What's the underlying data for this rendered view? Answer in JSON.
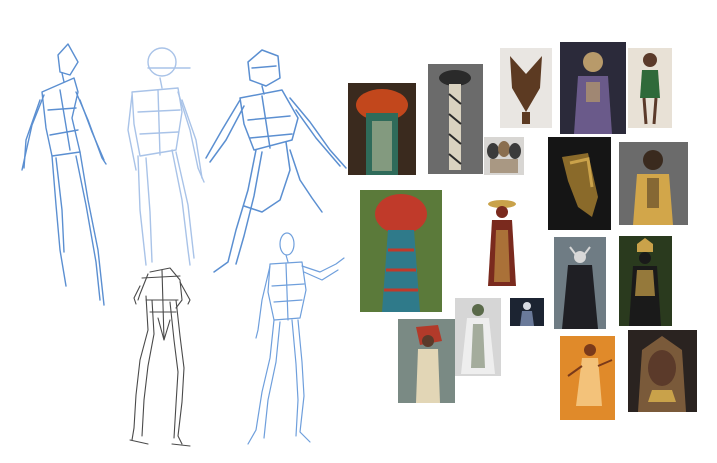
{
  "canvas": {
    "background": "#ffffff"
  },
  "sketch_colors": {
    "blue": "#5b8fd1",
    "light_blue": "#a9c3e8",
    "gray": "#4a4a4a",
    "mid_blue": "#6f9fdc"
  },
  "figure_sketches": [
    {
      "name": "gesture-figure-blue-standing",
      "color": "#5b8fd1"
    },
    {
      "name": "gesture-figure-lightblue-standing",
      "color": "#a9c3e8"
    },
    {
      "name": "gesture-figure-blue-action-pose",
      "color": "#5b8fd1"
    },
    {
      "name": "anatomy-figure-gray-front",
      "color": "#4a4a4a"
    },
    {
      "name": "anatomy-figure-blue-front",
      "color": "#6f9fdc"
    }
  ],
  "reference_images": [
    {
      "name": "ref-feather-headdress-costume",
      "bg": "#3a2a1e",
      "accent": "#c2471c",
      "detail": "#2f6b5a"
    },
    {
      "name": "ref-beaded-staff",
      "bg": "#6b6b6b",
      "accent": "#d9d2c0",
      "detail": "#2a2a2a"
    },
    {
      "name": "ref-carved-mask-sculpture",
      "bg": "#e9e6e2",
      "accent": "#5c3a22",
      "detail": "#c9b39a"
    },
    {
      "name": "ref-three-small-masks",
      "bg": "#d8d6d3",
      "accent": "#3b3b3b",
      "detail": "#8a6e4f"
    },
    {
      "name": "ref-warrior-woman-armor",
      "bg": "#2b2a3a",
      "accent": "#6a5a8a",
      "detail": "#b89a6a"
    },
    {
      "name": "ref-illustrated-girl-standing",
      "bg": "#e8e1d6",
      "accent": "#5b3a2a",
      "detail": "#2f6a3a"
    },
    {
      "name": "ref-gold-bird-mask-dark",
      "bg": "#151515",
      "accent": "#8a6a2a",
      "detail": "#caa24a"
    },
    {
      "name": "ref-braided-woman-gold-armor",
      "bg": "#6b6b6b",
      "accent": "#3a2a1e",
      "detail": "#d2a64a"
    },
    {
      "name": "ref-tall-round-headdress",
      "bg": "#5b7a3a",
      "accent": "#c03a2a",
      "detail": "#2f7a8a"
    },
    {
      "name": "ref-robed-figure-headdress",
      "bg": "#ffffff",
      "accent": "#7a2a1e",
      "detail": "#c9a24a"
    },
    {
      "name": "ref-horned-dark-sorceress",
      "bg": "#6f7c84",
      "accent": "#1f1f24",
      "detail": "#d8d8d8"
    },
    {
      "name": "ref-golden-crown-warrior",
      "bg": "#2a3a1e",
      "accent": "#caa24a",
      "detail": "#1a1a1a"
    },
    {
      "name": "ref-white-robed-figure",
      "bg": "#d6d6d6",
      "accent": "#5a6a4a",
      "detail": "#eeeeee"
    },
    {
      "name": "ref-small-dark-figure",
      "bg": "#1c2432",
      "accent": "#d7dbe2",
      "detail": "#6a7a9a"
    },
    {
      "name": "ref-red-hair-warrior-profile",
      "bg": "#7a8a84",
      "accent": "#b23a2a",
      "detail": "#e2d6b6"
    },
    {
      "name": "ref-desert-dancer-orange",
      "bg": "#e08a2a",
      "accent": "#f3c27a",
      "detail": "#7a3a1a"
    },
    {
      "name": "ref-hooded-woman-portrait",
      "bg": "#2a2320",
      "accent": "#7a5a3a",
      "detail": "#c9a24a"
    }
  ]
}
